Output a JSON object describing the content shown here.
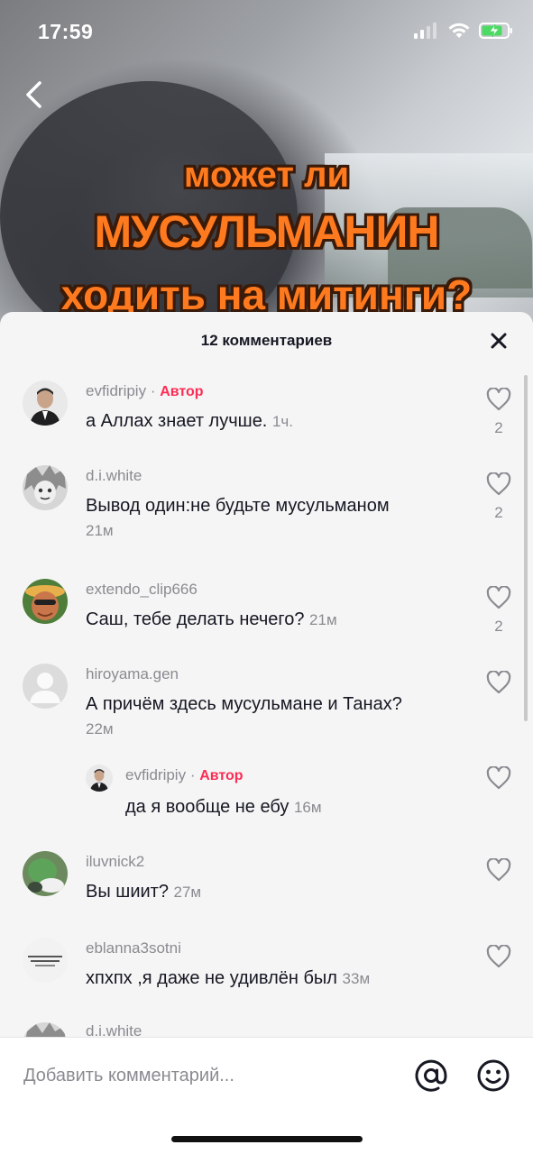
{
  "status_bar": {
    "time": "17:59"
  },
  "video": {
    "caption_line1": "может ли",
    "caption_line2": "МУСУЛЬМАНИН",
    "caption_line3": "ходить на митинги?"
  },
  "sheet": {
    "title": "12 комментариев"
  },
  "comments": [
    {
      "username": "evfidripiy",
      "author_dot": " · ",
      "author_tag": "Автор",
      "text": "а Аллах знает лучше.",
      "time": "1ч.",
      "likes": "2"
    },
    {
      "username": "d.i.white",
      "text": "Вывод один:не будьте мусульманом",
      "time": "21м",
      "likes": "2"
    },
    {
      "username": "extendo_clip666",
      "text": "Саш, тебе делать нечего?",
      "time": "21м",
      "likes": "2"
    },
    {
      "username": "hiroyama.gen",
      "text": "А причём здесь мусульмане и Танах?",
      "time": "22м",
      "likes": ""
    },
    {
      "username": "evfidripiy",
      "author_dot": " · ",
      "author_tag": "Автор",
      "text": "да я вообще не ебу",
      "time": "16м",
      "likes": "",
      "reply": true
    },
    {
      "username": "iluvnick2",
      "text": "Вы шиит?",
      "time": "27м",
      "likes": ""
    },
    {
      "username": "eblanna3sotni",
      "text": "хпхпх ,я даже не удивлён был",
      "time": "33м",
      "likes": ""
    },
    {
      "username": "d.i.white",
      "text": "",
      "time": "",
      "likes": ""
    }
  ],
  "input": {
    "placeholder": "Добавить комментарий..."
  },
  "icons": {
    "back": "chevron-left-icon",
    "close": "close-icon",
    "like": "heart-outline-icon",
    "mention": "at-sign-icon",
    "emoji": "smiley-icon"
  },
  "colors": {
    "author_tag": "#fe2c55",
    "caption": "#ff7a1f",
    "sheet_bg": "#f5f5f5"
  }
}
